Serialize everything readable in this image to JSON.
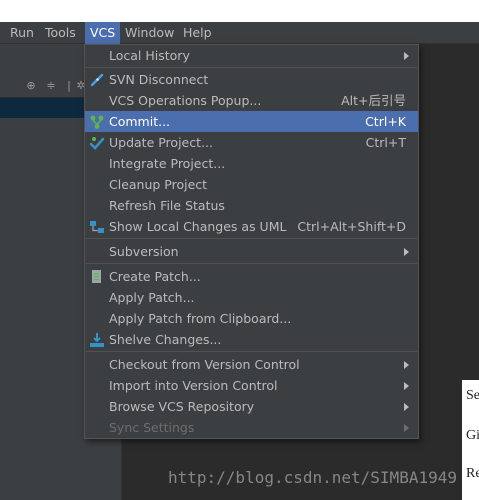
{
  "menubar": {
    "items": [
      {
        "label": "Run"
      },
      {
        "label": "Tools"
      },
      {
        "label": "VCS"
      },
      {
        "label": "Window"
      },
      {
        "label": "Help"
      }
    ]
  },
  "vcs_menu": {
    "items": [
      {
        "label": "Local History",
        "shortcut": "",
        "submenu": true
      },
      {
        "label": "SVN Disconnect",
        "shortcut": "",
        "icon": "svn-disconnect-icon"
      },
      {
        "label": "VCS Operations Popup...",
        "shortcut": "Alt+后引号"
      },
      {
        "label": "Commit...",
        "shortcut": "Ctrl+K",
        "icon": "commit-icon",
        "selected": true
      },
      {
        "label": "Update Project...",
        "shortcut": "Ctrl+T",
        "icon": "update-project-icon"
      },
      {
        "label": "Integrate Project...",
        "shortcut": ""
      },
      {
        "label": "Cleanup Project",
        "shortcut": ""
      },
      {
        "label": "Refresh File Status",
        "shortcut": ""
      },
      {
        "label": "Show Local Changes as UML",
        "shortcut": "Ctrl+Alt+Shift+D",
        "icon": "uml-icon"
      },
      {
        "label": "Subversion",
        "shortcut": "",
        "submenu": true
      },
      {
        "label": "Create Patch...",
        "shortcut": "",
        "icon": "create-patch-icon"
      },
      {
        "label": "Apply Patch...",
        "shortcut": ""
      },
      {
        "label": "Apply Patch from Clipboard...",
        "shortcut": ""
      },
      {
        "label": "Shelve Changes...",
        "shortcut": "",
        "icon": "shelve-icon"
      },
      {
        "label": "Checkout from Version Control",
        "shortcut": "",
        "submenu": true
      },
      {
        "label": "Import into Version Control",
        "shortcut": "",
        "submenu": true
      },
      {
        "label": "Browse VCS Repository",
        "shortcut": "",
        "submenu": true
      },
      {
        "label": "Sync Settings",
        "shortcut": "",
        "submenu": true,
        "disabled": true
      }
    ]
  },
  "right_partial": {
    "line1": "Se",
    "line2": "Gi",
    "line3": "Re"
  },
  "watermark": "http://blog.csdn.net/SIMBA1949",
  "colors": {
    "menu_bg": "#3c3f41",
    "selection": "#4b6eaf",
    "editor_bg": "#2b2b2b",
    "text": "#bbbbbb"
  }
}
